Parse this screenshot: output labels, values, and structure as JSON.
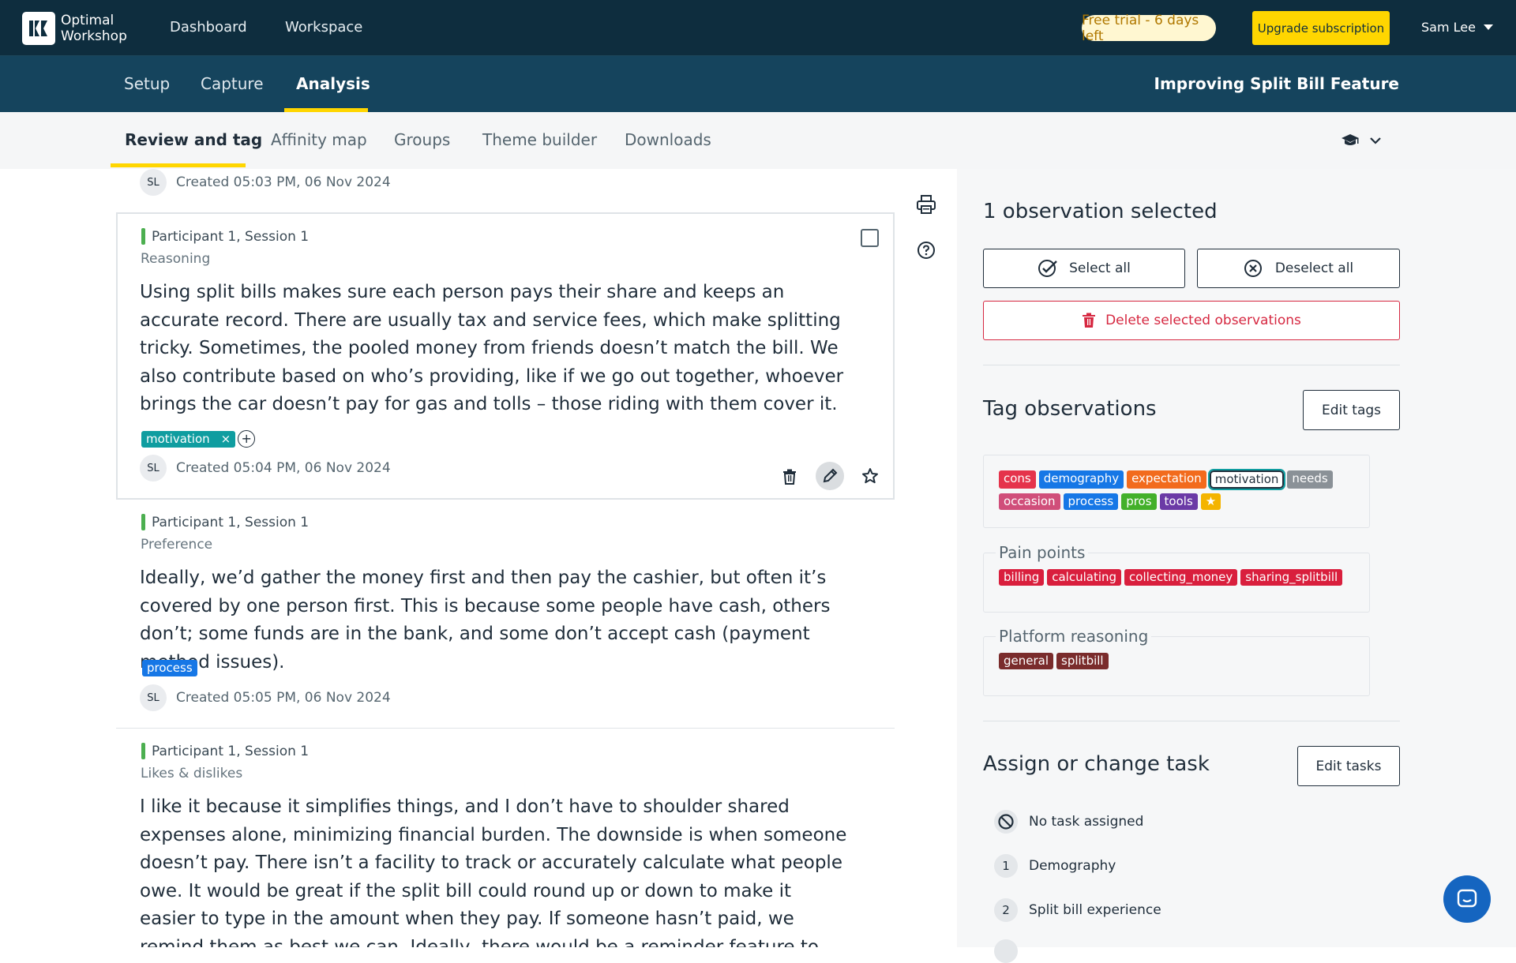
{
  "app": {
    "logo_line1": "Optimal",
    "logo_line2": "Workshop"
  },
  "topnav": {
    "dashboard": "Dashboard",
    "workspace": "Workspace"
  },
  "trial": {
    "label": "Free trial - 6 days left"
  },
  "upgrade": {
    "label": "Upgrade subscription"
  },
  "user": {
    "name": "Sam Lee"
  },
  "section_tabs": {
    "setup": "Setup",
    "capture": "Capture",
    "analysis": "Analysis",
    "active": "Analysis"
  },
  "project": {
    "title": "Improving Split Bill Feature"
  },
  "sub_tabs": {
    "review": "Review and tag",
    "affinity": "Affinity map",
    "groups": "Groups",
    "theme": "Theme builder",
    "downloads": "Downloads",
    "active": "Review and tag"
  },
  "observations": [
    {
      "created": "Created 05:03 PM, 06 Nov 2024",
      "initials": "SL"
    },
    {
      "participant": "Participant 1, Session 1",
      "category": "Reasoning",
      "text": "Using split bills makes sure each person pays their share and keeps an accurate record. There are usually tax and service fees, which make splitting tricky. Sometimes, the pooled money from friends doesn’t match the bill. We also contribute based on who’s providing, like if we go out together, whoever brings the car doesn’t pay for gas and tolls – those riding with them cover it.",
      "tag": "motivation",
      "tag_remove": "×",
      "add_tag": "+",
      "initials": "SL",
      "created": "Created 05:04 PM, 06 Nov 2024",
      "selected": true
    },
    {
      "participant": "Participant 1, Session 1",
      "category": "Preference",
      "text": "Ideally, we’d gather the money first and then pay the cashier, but often it’s covered by one person first. This is because some people have cash, others don’t; some funds are in the bank, and some don’t accept cash (payment method issues).",
      "tag": "process",
      "initials": "SL",
      "created": "Created 05:05 PM, 06 Nov 2024"
    },
    {
      "participant": "Participant 1, Session 1",
      "category": "Likes & dislikes",
      "text": "I like it because it simplifies things, and I don’t have to shoulder shared expenses alone, minimizing financial burden. The downside is when someone doesn’t pay. There isn’t a facility to track or accurately calculate what people owe. It would be great if the split bill could round up or down to make it easier to type in the amount when they pay. If someone hasn’t paid, we remind them as best we can. Ideally, there would be a reminder feature to prompt them to pay, as not everyone tracks their expenses."
    }
  ],
  "right_panel": {
    "selected_count": "1 observation selected",
    "select_all": "Select all",
    "deselect_all": "Deselect all",
    "delete_selected": "Delete selected observations",
    "tag_heading": "Tag observations",
    "edit_tags": "Edit tags",
    "tags_row1": [
      {
        "label": "cons",
        "color": "#e5334b"
      },
      {
        "label": "demography",
        "color": "#1677e6"
      },
      {
        "label": "expectation",
        "color": "#f26b1d"
      },
      {
        "label": "motivation",
        "color": "#0f9da0",
        "selected": true
      },
      {
        "label": "needs",
        "color": "#8a9197"
      }
    ],
    "tags_row2": [
      {
        "label": "occasion",
        "color": "#d04e7a"
      },
      {
        "label": "process",
        "color": "#1677e6"
      },
      {
        "label": "pros",
        "color": "#43b02a"
      },
      {
        "label": "tools",
        "color": "#6b3aa6"
      },
      {
        "label": "★",
        "color": "#f4b400"
      }
    ],
    "group_pain": "Pain points",
    "pain_tags": [
      "billing",
      "calculating",
      "collecting_money",
      "sharing_splitbill"
    ],
    "group_platform": "Platform reasoning",
    "platform_tags": [
      "general",
      "splitbill"
    ],
    "task_heading": "Assign or change task",
    "edit_tasks": "Edit tasks",
    "tasks": [
      {
        "num": "",
        "label": "No task assigned"
      },
      {
        "num": "1",
        "label": "Demography"
      },
      {
        "num": "2",
        "label": "Split bill experience"
      }
    ]
  },
  "colors": {
    "nav_dark": "#0e2d3e",
    "nav_secondary": "#15445d",
    "accent_yellow": "#ffd600",
    "danger": "#d62841"
  },
  "icons": [
    "print-icon",
    "help-icon",
    "trash-icon",
    "pencil-icon",
    "star-icon",
    "graduation-cap-icon",
    "chevron-down-icon",
    "check-circle-icon",
    "x-circle-icon",
    "no-task-icon",
    "chat-icon"
  ]
}
